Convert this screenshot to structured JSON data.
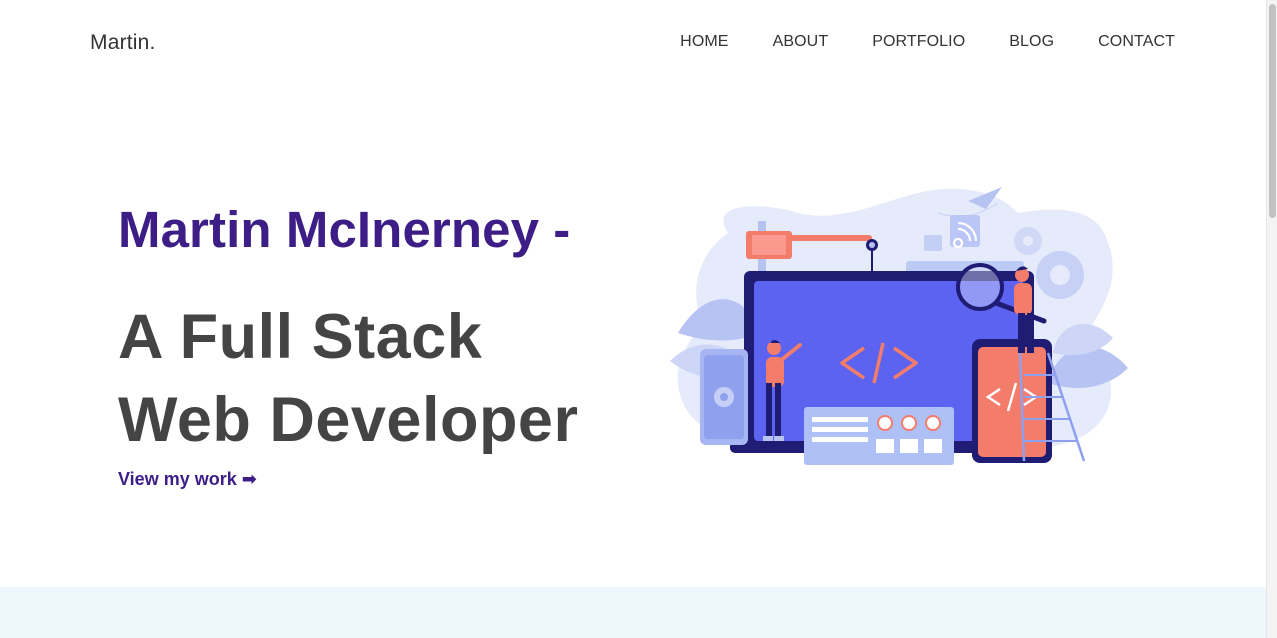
{
  "brand": "Martin.",
  "nav": [
    "HOME",
    "ABOUT",
    "PORTFOLIO",
    "BLOG",
    "CONTACT"
  ],
  "hero": {
    "name": "Martin McInerney -",
    "title_line1": "A Full Stack",
    "title_line2": "Web Developer",
    "cta": "View my work ➡"
  },
  "colors": {
    "accent": "#3d1e86",
    "heading": "#444444",
    "band": "#eef8fc",
    "illustration_blue": "#5b63f0",
    "illustration_coral": "#f47c6b",
    "illustration_navy": "#1f1c74"
  }
}
